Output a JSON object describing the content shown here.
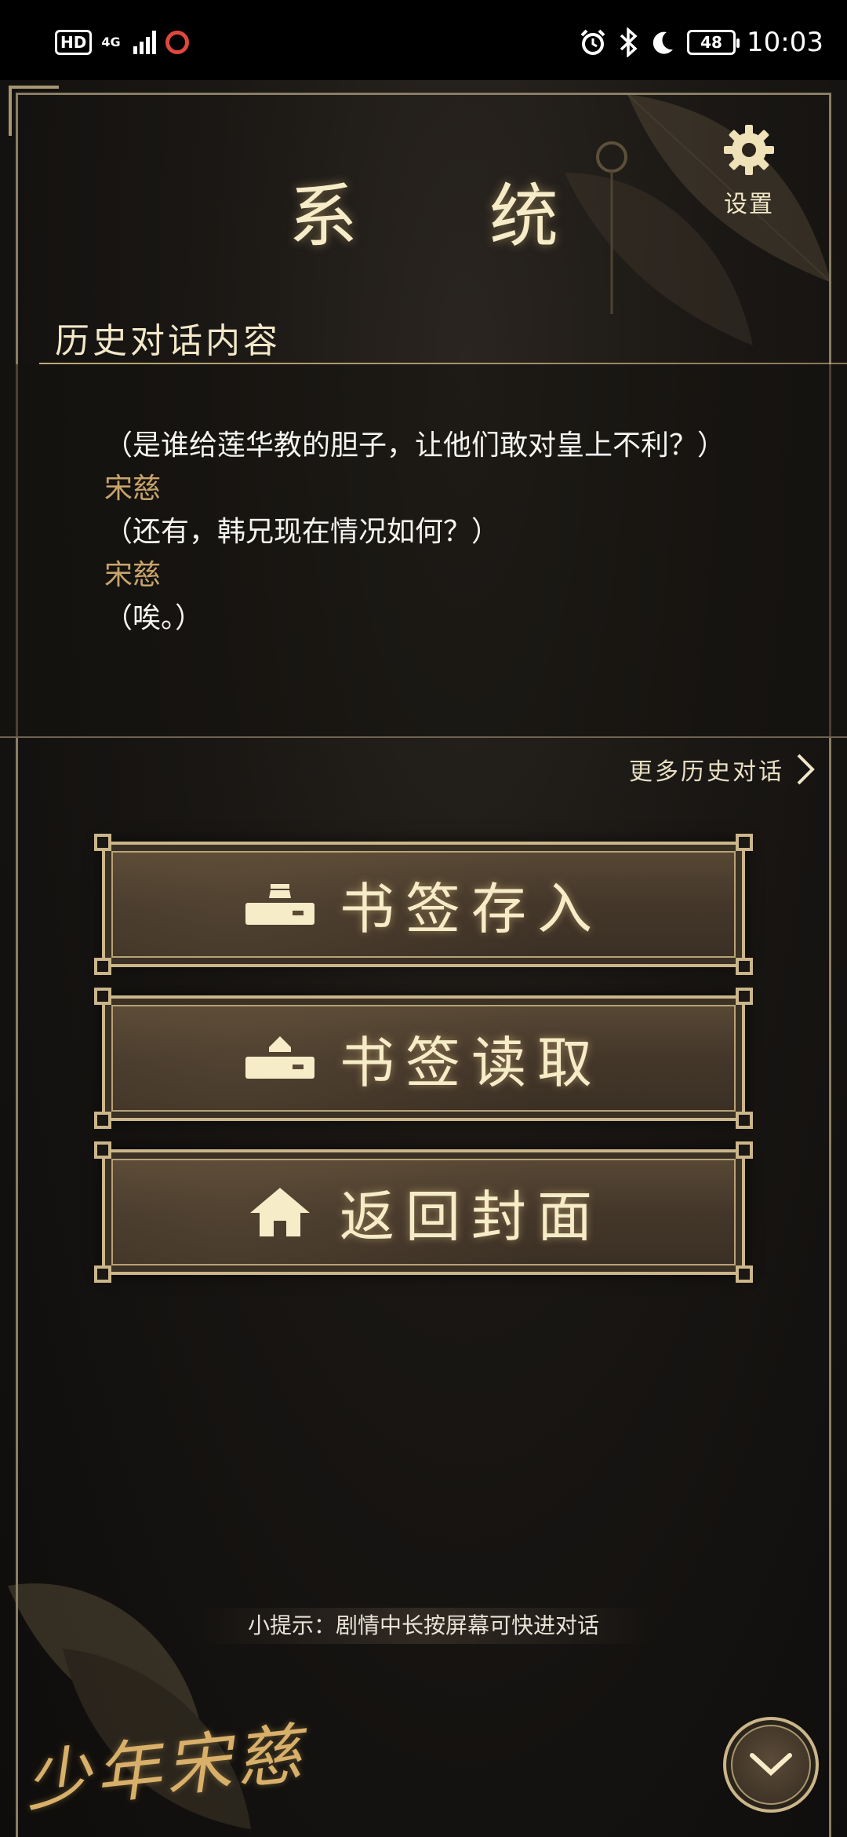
{
  "status_bar": {
    "hd": "HD",
    "network": "4G",
    "battery": "48",
    "time": "10:03"
  },
  "header": {
    "title": "系 统",
    "settings_label": "设置"
  },
  "history": {
    "title": "历史对话内容",
    "lines": [
      {
        "type": "text",
        "text": "（是谁给莲华教的胆子，让他们敢对皇上不利？）"
      },
      {
        "type": "speaker",
        "text": "宋慈"
      },
      {
        "type": "text",
        "text": "（还有，韩兄现在情况如何？）"
      },
      {
        "type": "speaker",
        "text": "宋慈"
      },
      {
        "type": "text",
        "text": "（唉。）"
      }
    ],
    "more_label": "更多历史对话"
  },
  "menu": {
    "save_label": "书签存入",
    "load_label": "书签读取",
    "home_label": "返回封面"
  },
  "tip": "小提示：剧情中长按屏幕可快进对话",
  "logo_text": "少年宋慈",
  "colors": {
    "gold": "#cbb68a",
    "cream": "#f7ecc8",
    "speaker": "#c9a46a",
    "background": "#141210"
  }
}
